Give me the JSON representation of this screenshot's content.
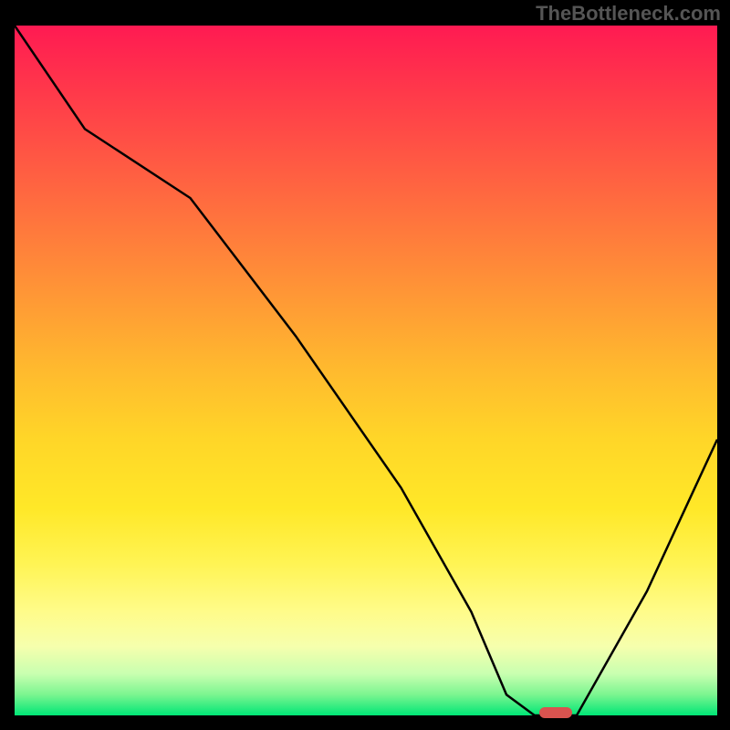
{
  "watermark": "TheBottleneck.com",
  "colors": {
    "gradient_top": "#ff1a52",
    "gradient_bottom": "#00e676",
    "curve": "#000000",
    "marker": "#d9534f",
    "axis": "#000000",
    "background": "#000000"
  },
  "chart_data": {
    "type": "line",
    "title": "",
    "xlabel": "",
    "ylabel": "",
    "xlim": [
      0,
      100
    ],
    "ylim": [
      0,
      100
    ],
    "x": [
      0,
      10,
      25,
      40,
      55,
      65,
      70,
      74,
      80,
      90,
      100
    ],
    "values": [
      100,
      85,
      75,
      55,
      33,
      15,
      3,
      0,
      0,
      18,
      40
    ],
    "marker": {
      "x": 77,
      "y": 0
    },
    "annotations": []
  }
}
